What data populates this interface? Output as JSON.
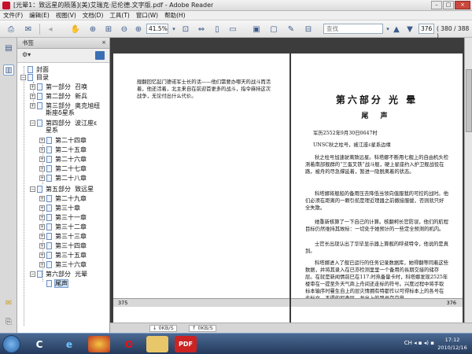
{
  "window": {
    "title": "[光晕1：致远星的陨落](美)艾瑞克·尼伦德.文字版.pdf - Adobe Reader"
  },
  "menubar": [
    "文件(F)",
    "编辑(E)",
    "视图(V)",
    "文档(D)",
    "工具(T)",
    "窗口(W)",
    "帮助(H)"
  ],
  "toolbar": {
    "zoom": "41.5%",
    "search_placeholder": "查找",
    "page": "376",
    "page_count": "( 380 / 388 )"
  },
  "bookmarks": {
    "header": "书签",
    "close_icon": "×",
    "options_icon": "⚙▾",
    "tree": [
      {
        "label": "封面",
        "expander": ""
      },
      {
        "label": "目录",
        "expander": "−"
      },
      {
        "label": "第一部分  召唤",
        "expander": "+"
      },
      {
        "label": "第二部分  新兵",
        "expander": "+"
      },
      {
        "label": "第三部分  奥克旭纽\n斯座δ星系",
        "expander": "+"
      },
      {
        "label": "第四部分  波江座ε\n星系",
        "expander": "−"
      },
      {
        "label": "第二十四章",
        "expander": "+"
      },
      {
        "label": "第二十五章",
        "expander": "+"
      },
      {
        "label": "第二十六章",
        "expander": "+"
      },
      {
        "label": "第二十七章",
        "expander": "+"
      },
      {
        "label": "第二十八章",
        "expander": "+"
      },
      {
        "label": "第五部分  致远星",
        "expander": "−"
      },
      {
        "label": "第二十九章",
        "expander": "+"
      },
      {
        "label": "第三十章",
        "expander": "+"
      },
      {
        "label": "第三十一章",
        "expander": "+"
      },
      {
        "label": "第三十二章",
        "expander": "+"
      },
      {
        "label": "第三十三章",
        "expander": "+"
      },
      {
        "label": "第三十四章",
        "expander": "+"
      },
      {
        "label": "第三十五章",
        "expander": "+"
      },
      {
        "label": "第三十六章",
        "expander": "+"
      },
      {
        "label": "第六部分  光晕",
        "expander": "−"
      },
      {
        "label": "尾声",
        "expander": ""
      }
    ]
  },
  "document": {
    "left_text": "舰翻回忆起门德诺军士长的话——他们需要办哪天的战斗而活着，他还活着，北主来自在前迎首更多的战斗，指令麻持这次战争，无论付出什么代价。",
    "left_page_number": "375",
    "right_title": "第六部分   光  晕",
    "right_subtitle": "尾  声",
    "right_date": "军历2552年9月30日0647时",
    "right_org": "UNSC秋之柱号，被江座ε星系边缘",
    "right_paragraphs": [
      "秋之柱号加速驶离致远星。科塔娜不断用七舰上的自由机头检测着南部舰群的“三蛋叉铁”战斗舰，硬上星座约入护卫舰战役在路，被舟的尽急撑延着，暂进一隐脱离着的状态。",
      "科塔娜将舰船的备用压去降低当领向值服我的可控的战时。他们必须在距离的一颗引航是理近理器之前撤接服援，否则就只好全失散。",
      "她重新核算了一下自己的计算。核翻柯长官防误，他们的航程目标仍然维持其故标：一切处于她预计的一些定全预测的机内。",
      "士官长出现认出了华毕显示器上算舰的呼叔特令，他说的是真到。",
      "科塔娜进入了舰已运行的任务记录数据库，她得翻等同着这些数据，并将其录入在已亦检测里里一个备用的長期交接的储存层。在就是新闻情前巳在117.时热备量卡时，科塔娜发现2525年楼审在一提至外天气商上舟间还走标的符号。兴度过程中将手取标本输序时曼生自上的层灾情拥有特都作以可得标本上的各号在此标文，不得的探查层，龙出上的路号存交量"
    ],
    "right_page_number": "376"
  },
  "statusbar": {
    "speed1": "0KB/S",
    "speed2": "0KB/S"
  },
  "taskbar": {
    "clock_time": "17:12",
    "clock_date": "2010/12/16",
    "tray": "CH ◂ ▪ ◂) ▪"
  },
  "colors": {
    "page_bg": "#ffffff",
    "doc_bg": "#3c3c3c",
    "selection": "#c6dcf5",
    "taskbar": "#243a5c"
  }
}
